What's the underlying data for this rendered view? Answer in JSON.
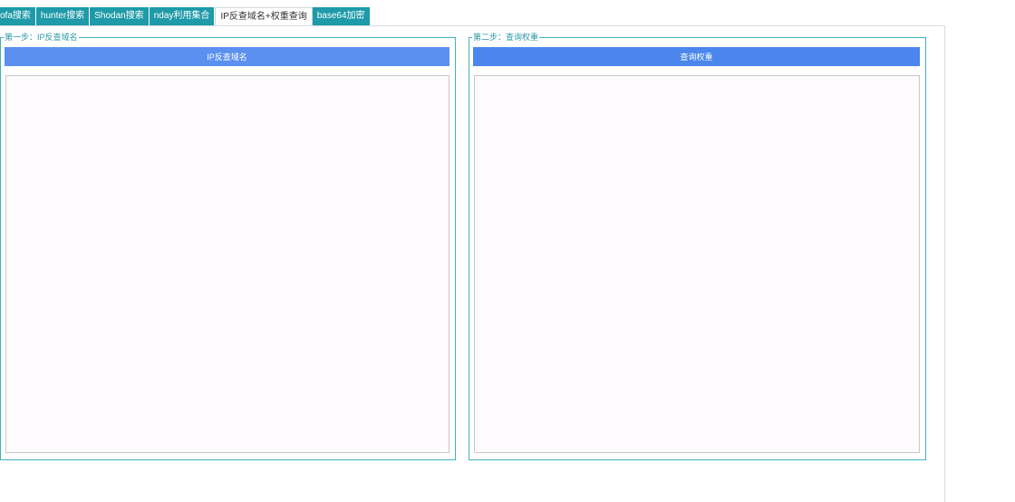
{
  "tabs": [
    {
      "label": "ofa搜索",
      "active": false
    },
    {
      "label": "hunter搜索",
      "active": false
    },
    {
      "label": "Shodan搜索",
      "active": false
    },
    {
      "label": "nday利用集合",
      "active": false
    },
    {
      "label": "IP反查域名+权重查询",
      "active": true
    },
    {
      "label": "base64加密",
      "active": false
    }
  ],
  "step1": {
    "legend": "第一步：IP反查域名",
    "button_label": "IP反查域名",
    "output_value": ""
  },
  "step2": {
    "legend": "第二步：查询权重",
    "button_label": "查询权重",
    "output_value": ""
  },
  "colors": {
    "tab_bg": "#1e9aa8",
    "group_border": "#3fb3bd",
    "button_ip": "#5b8ff0",
    "button_weight": "#4a86ec"
  }
}
